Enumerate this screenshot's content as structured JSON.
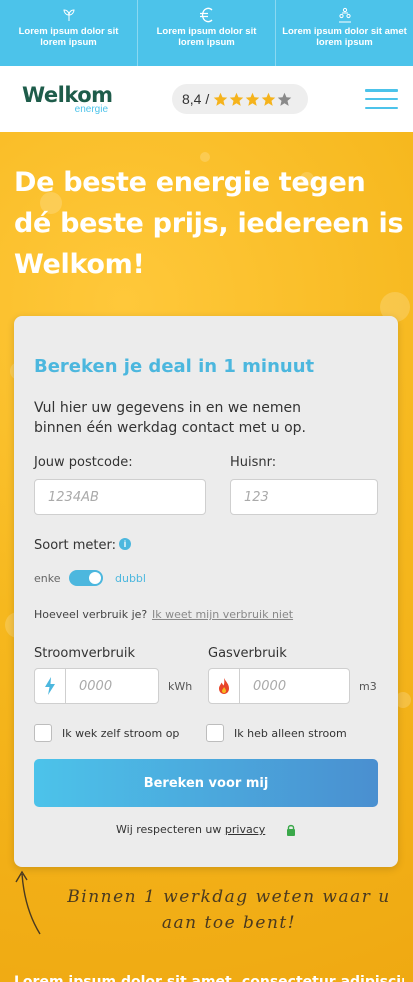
{
  "usp_bar": {
    "items": [
      {
        "icon": "leaf-icon",
        "text": "Lorem ipsum dolor sit lorem ipsum"
      },
      {
        "icon": "euro-icon",
        "text": "Lorem ipsum dolor sit lorem ipsum"
      },
      {
        "icon": "people-icon",
        "text": "Lorem ipsum dolor sit amet lorem ipsum"
      }
    ],
    "color": "#4cc3ea"
  },
  "header": {
    "logo_main": "Welkom",
    "logo_sub": "energie",
    "rating_score": "8,4 /",
    "rating_stars": 4,
    "rating_max": 5
  },
  "hero": {
    "title": "De beste energie tegen dé beste prijs, iedereen is Welkom!"
  },
  "form": {
    "title": "Bereken je deal in 1 minuut",
    "intro": "Vul hier uw gegevens in en we nemen binnen één werkdag contact met u op.",
    "postcode_label": "Jouw postcode:",
    "postcode_placeholder": "1234AB",
    "huisnr_label": "Huisnr:",
    "huisnr_placeholder": "123",
    "meter_label": "Soort meter:",
    "meter_left": "enke",
    "meter_right": "dubbl",
    "usage_question": "Hoeveel verbruik je?",
    "usage_link": "Ik weet mijn verbruik niet",
    "power_label": "Stroomverbruik",
    "power_placeholder": "0000",
    "power_unit": "kWh",
    "gas_label": "Gasverbruik",
    "gas_placeholder": "0000",
    "gas_unit": "m3",
    "check_own_power": "Ik wek zelf stroom op",
    "check_only_power": "Ik heb alleen stroom",
    "submit_label": "Bereken voor mij",
    "privacy_prefix": "Wij respecteren uw",
    "privacy_link": "privacy"
  },
  "note": {
    "handwritten": "Binnen 1 werkdag weten waar u aan toe bent!"
  },
  "footer_teaser": "Lorem ipsum dolor sit amet, consectetur adipiscing"
}
